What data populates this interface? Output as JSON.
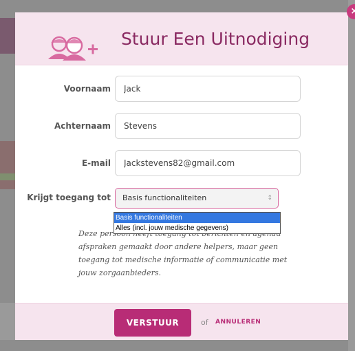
{
  "modal": {
    "title": "Stuur Een Uitnodiging",
    "accent_color": "#b82c76",
    "header_bg": "#f6e4ee",
    "icon": "add-users-icon"
  },
  "form": {
    "first_name": {
      "label": "Voornaam",
      "value": "Jack"
    },
    "last_name": {
      "label": "Achternaam",
      "value": "Stevens"
    },
    "email": {
      "label": "E-mail",
      "value": "Jackstevens82@gmail.com"
    },
    "access": {
      "label": "Krijgt toegang tot",
      "selected": "Basis functionaliteiten",
      "options": [
        "Basis functionaliteiten",
        "Alles (incl. jouw medische gegevens)"
      ]
    },
    "help_text": "Deze persoon heeft toegang tot berichten en agenda afspraken gemaakt door andere helpers, maar geen toegang tot medische informatie of communicatie met jouw zorgaanbieders."
  },
  "footer": {
    "submit_label": "VERSTUUR",
    "or_text": "of",
    "cancel_label": "ANNULEREN"
  }
}
